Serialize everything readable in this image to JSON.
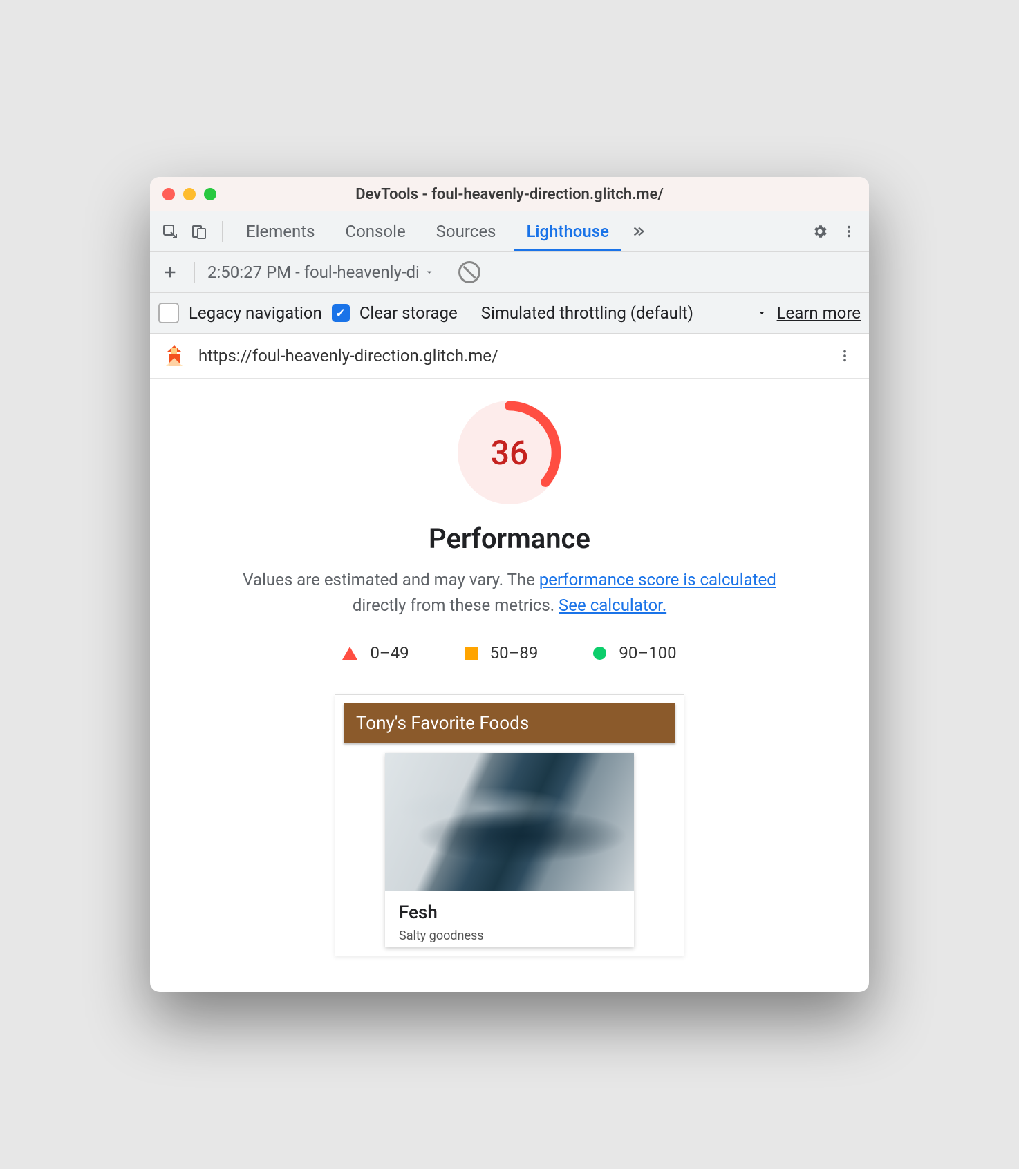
{
  "window": {
    "title": "DevTools - foul-heavenly-direction.glitch.me/"
  },
  "tabs": {
    "items": [
      "Elements",
      "Console",
      "Sources",
      "Lighthouse"
    ],
    "active": "Lighthouse"
  },
  "secondbar": {
    "report_select": "2:50:27 PM - foul-heavenly-di"
  },
  "options": {
    "legacy_label": "Legacy navigation",
    "legacy_checked": false,
    "clear_label": "Clear storage",
    "clear_checked": true,
    "throttle_label": "Simulated throttling (default)",
    "learn_more": "Learn more"
  },
  "url": "https://foul-heavenly-direction.glitch.me/",
  "score": {
    "value": "36",
    "category": "Performance",
    "desc_pre": "Values are estimated and may vary. The ",
    "link1": "performance score is calculated",
    "desc_mid": " directly from these metrics. ",
    "link2": "See calculator.",
    "legend": {
      "fail": "0–49",
      "avg": "50–89",
      "pass": "90–100"
    }
  },
  "preview": {
    "banner": "Tony's Favorite Foods",
    "card_title": "Fesh",
    "card_sub": "Salty goodness"
  }
}
